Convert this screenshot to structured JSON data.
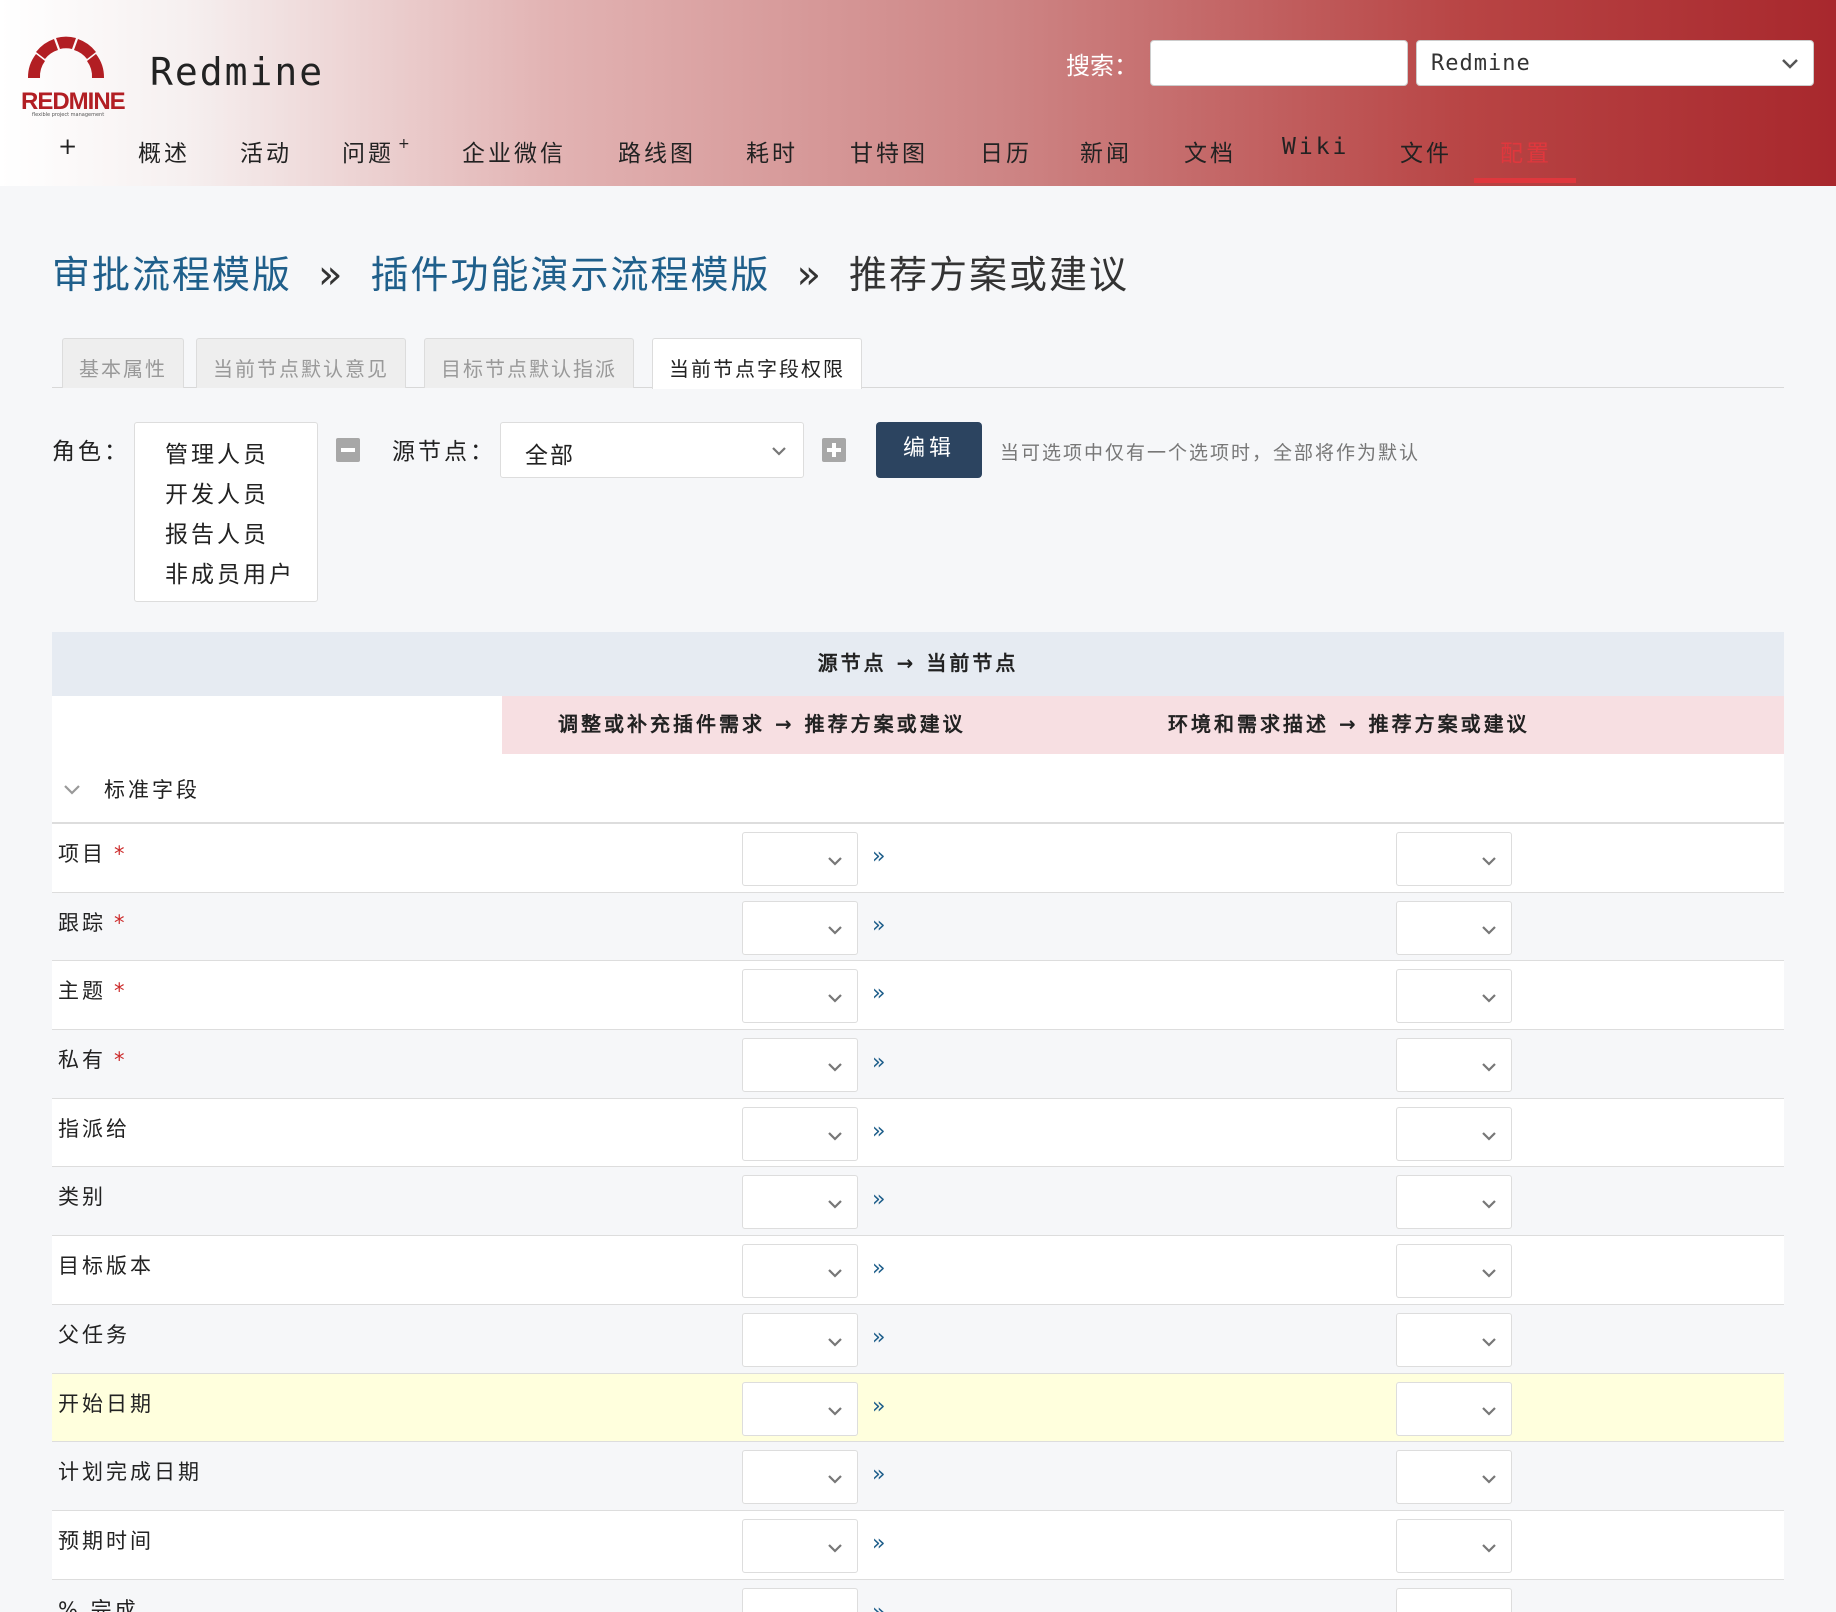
{
  "header": {
    "logo_text": "REDMINE",
    "logo_subtitle": "flexible project management",
    "app_title": "Redmine",
    "search_label": "搜索：",
    "search_value": "",
    "project_select": "Redmine"
  },
  "menu": {
    "plus": "+",
    "items": [
      "概述",
      "活动",
      "问题",
      "企业微信",
      "路线图",
      "耗时",
      "甘特图",
      "日历",
      "新闻",
      "文档",
      "Wiki",
      "文件",
      "配置"
    ],
    "issues_sup": "+",
    "selected": "配置"
  },
  "breadcrumb": {
    "level1": "审批流程模版",
    "sep": "»",
    "level2": "插件功能演示流程模版",
    "current": "推荐方案或建议"
  },
  "tabs": [
    "基本属性",
    "当前节点默认意见",
    "目标节点默认指派",
    "当前节点字段权限"
  ],
  "filter": {
    "role_label": "角色：",
    "roles": [
      "管理人员",
      "开发人员",
      "报告人员",
      "非成员用户"
    ],
    "source_label": "源节点：",
    "source_value": "全部",
    "edit_button": "编辑",
    "hint": "当可选项中仅有一个选项时，全部将作为默认"
  },
  "table": {
    "header_top": "源节点 → 当前节点",
    "columns": [
      "调整或补充插件需求 → 推荐方案或建议",
      "环境和需求描述 → 推荐方案或建议"
    ],
    "section_label": "标准字段",
    "link_glyph": "»",
    "required_mark": "*",
    "rows": [
      {
        "label": "项目",
        "required": true
      },
      {
        "label": "跟踪",
        "required": true
      },
      {
        "label": "主题",
        "required": true
      },
      {
        "label": "私有",
        "required": true
      },
      {
        "label": "指派给",
        "required": false
      },
      {
        "label": "类别",
        "required": false
      },
      {
        "label": "目标版本",
        "required": false
      },
      {
        "label": "父任务",
        "required": false
      },
      {
        "label": "开始日期",
        "required": false,
        "highlighted": true
      },
      {
        "label": "计划完成日期",
        "required": false
      },
      {
        "label": "预期时间",
        "required": false
      },
      {
        "label": "% 完成",
        "required": false
      }
    ]
  },
  "colors": {
    "accent_red": "#e0373d",
    "link_blue": "#1f5f8b",
    "button_dark": "#2c4460",
    "required_red": "#cc2a2a",
    "highlight_row": "#ffffdd"
  }
}
